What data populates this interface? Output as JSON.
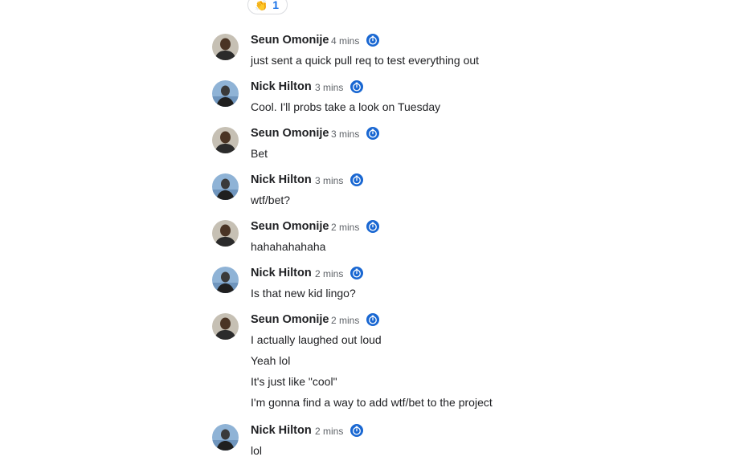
{
  "reaction": {
    "emoji": "👏",
    "count": "1"
  },
  "messages": [
    {
      "author": "Seun Omonije",
      "time": "4 mins",
      "lines": [
        "just sent a quick pull req to test everything out"
      ]
    },
    {
      "author": "Nick Hilton",
      "time": "3 mins",
      "lines": [
        "Cool. I'll probs take a look on Tuesday"
      ]
    },
    {
      "author": "Seun Omonije",
      "time": "3 mins",
      "lines": [
        "Bet"
      ]
    },
    {
      "author": "Nick Hilton",
      "time": "3 mins",
      "lines": [
        "wtf/bet?"
      ]
    },
    {
      "author": "Seun Omonije",
      "time": "2 mins",
      "lines": [
        "hahahahahaha"
      ]
    },
    {
      "author": "Nick Hilton",
      "time": "2 mins",
      "lines": [
        "Is that new kid lingo?"
      ]
    },
    {
      "author": "Seun Omonije",
      "time": "2 mins",
      "lines": [
        "I actually laughed out loud",
        "Yeah lol",
        "It's just like \"cool\"",
        "I'm gonna find a way to add wtf/bet to the project"
      ]
    },
    {
      "author": "Nick Hilton",
      "time": "2 mins",
      "lines": [
        "lol"
      ]
    }
  ],
  "colors": {
    "accent": "#1a73e8",
    "timer_icon": "#1967d2"
  },
  "icons": {
    "timer": "timer-icon",
    "avatar": "avatar"
  }
}
